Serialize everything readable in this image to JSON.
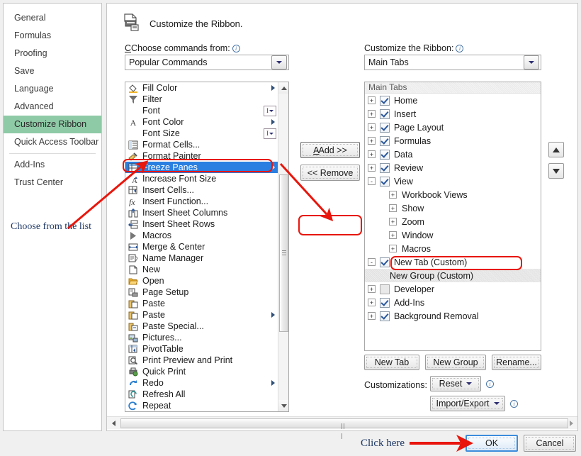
{
  "sidebar": {
    "items": [
      {
        "label": "General",
        "selected": false
      },
      {
        "label": "Formulas",
        "selected": false
      },
      {
        "label": "Proofing",
        "selected": false
      },
      {
        "label": "Save",
        "selected": false
      },
      {
        "label": "Language",
        "selected": false
      },
      {
        "label": "Advanced",
        "selected": false
      },
      {
        "label": "Customize Ribbon",
        "selected": true
      },
      {
        "label": "Quick Access Toolbar",
        "selected": false
      },
      {
        "label": "Add-Ins",
        "selected": false
      },
      {
        "label": "Trust Center",
        "selected": false
      }
    ],
    "annotation": "Choose from the list"
  },
  "header": {
    "title": "Customize the Ribbon.",
    "icon": "print-save-icon"
  },
  "left_panel": {
    "label": "Choose commands from:",
    "label_accel": "C",
    "info_icon": "info-icon",
    "combo_value": "Popular Commands",
    "commands": [
      {
        "label": "Fill Color",
        "icon": "fill-color-icon",
        "submenu": true,
        "spinner": false,
        "selected": false
      },
      {
        "label": "Filter",
        "icon": "filter-icon",
        "submenu": false,
        "spinner": false,
        "selected": false
      },
      {
        "label": "Font",
        "icon": "none",
        "submenu": false,
        "spinner": true,
        "selected": false
      },
      {
        "label": "Font Color",
        "icon": "font-color-icon",
        "submenu": true,
        "spinner": false,
        "selected": false
      },
      {
        "label": "Font Size",
        "icon": "none",
        "submenu": false,
        "spinner": true,
        "selected": false
      },
      {
        "label": "Format Cells...",
        "icon": "format-cells-icon",
        "submenu": false,
        "spinner": false,
        "selected": false
      },
      {
        "label": "Format Painter",
        "icon": "format-painter-icon",
        "submenu": false,
        "spinner": false,
        "selected": false
      },
      {
        "label": "Freeze Panes",
        "icon": "freeze-panes-icon",
        "submenu": true,
        "spinner": false,
        "selected": true
      },
      {
        "label": "Increase Font Size",
        "icon": "increase-font-size-icon",
        "submenu": false,
        "spinner": false,
        "selected": false
      },
      {
        "label": "Insert Cells...",
        "icon": "insert-cells-icon",
        "submenu": false,
        "spinner": false,
        "selected": false
      },
      {
        "label": "Insert Function...",
        "icon": "insert-function-icon",
        "submenu": false,
        "spinner": false,
        "selected": false
      },
      {
        "label": "Insert Sheet Columns",
        "icon": "insert-sheet-columns-icon",
        "submenu": false,
        "spinner": false,
        "selected": false
      },
      {
        "label": "Insert Sheet Rows",
        "icon": "insert-sheet-rows-icon",
        "submenu": false,
        "spinner": false,
        "selected": false
      },
      {
        "label": "Macros",
        "icon": "macros-icon",
        "submenu": false,
        "spinner": false,
        "selected": false
      },
      {
        "label": "Merge & Center",
        "icon": "merge-center-icon",
        "submenu": false,
        "spinner": false,
        "selected": false
      },
      {
        "label": "Name Manager",
        "icon": "name-manager-icon",
        "submenu": false,
        "spinner": false,
        "selected": false
      },
      {
        "label": "New",
        "icon": "new-file-icon",
        "submenu": false,
        "spinner": false,
        "selected": false
      },
      {
        "label": "Open",
        "icon": "open-folder-icon",
        "submenu": false,
        "spinner": false,
        "selected": false
      },
      {
        "label": "Page Setup",
        "icon": "page-setup-icon",
        "submenu": false,
        "spinner": false,
        "selected": false
      },
      {
        "label": "Paste",
        "icon": "paste-icon",
        "submenu": false,
        "spinner": false,
        "selected": false
      },
      {
        "label": "Paste",
        "icon": "paste-icon",
        "submenu": true,
        "spinner": false,
        "selected": false
      },
      {
        "label": "Paste Special...",
        "icon": "paste-special-icon",
        "submenu": false,
        "spinner": false,
        "selected": false
      },
      {
        "label": "Pictures...",
        "icon": "pictures-icon",
        "submenu": false,
        "spinner": false,
        "selected": false
      },
      {
        "label": "PivotTable",
        "icon": "pivottable-icon",
        "submenu": false,
        "spinner": false,
        "selected": false
      },
      {
        "label": "Print Preview and Print",
        "icon": "print-preview-icon",
        "submenu": false,
        "spinner": false,
        "selected": false
      },
      {
        "label": "Quick Print",
        "icon": "quick-print-icon",
        "submenu": false,
        "spinner": false,
        "selected": false
      },
      {
        "label": "Redo",
        "icon": "redo-icon",
        "submenu": true,
        "spinner": false,
        "selected": false
      },
      {
        "label": "Refresh All",
        "icon": "refresh-all-icon",
        "submenu": false,
        "spinner": false,
        "selected": false
      },
      {
        "label": "Repeat",
        "icon": "repeat-icon",
        "submenu": false,
        "spinner": false,
        "selected": false
      }
    ]
  },
  "middle": {
    "add_label": "Add >>",
    "add_accel": "A",
    "remove_label": "<< Remove",
    "remove_accel": "R"
  },
  "right_panel": {
    "label": "Customize the Ribbon:",
    "info_icon": "info-icon",
    "combo_value": "Main Tabs",
    "tree_header": "Main Tabs",
    "tree": [
      {
        "label": "Home",
        "expander": "+",
        "checkbox": "checked",
        "indent": false,
        "selected": false
      },
      {
        "label": "Insert",
        "expander": "+",
        "checkbox": "checked",
        "indent": false,
        "selected": false
      },
      {
        "label": "Page Layout",
        "expander": "+",
        "checkbox": "checked",
        "indent": false,
        "selected": false
      },
      {
        "label": "Formulas",
        "expander": "+",
        "checkbox": "checked",
        "indent": false,
        "selected": false
      },
      {
        "label": "Data",
        "expander": "+",
        "checkbox": "checked",
        "indent": false,
        "selected": false
      },
      {
        "label": "Review",
        "expander": "+",
        "checkbox": "checked",
        "indent": false,
        "selected": false
      },
      {
        "label": "View",
        "expander": "-",
        "checkbox": "checked",
        "indent": false,
        "selected": false
      },
      {
        "label": "Workbook Views",
        "expander": "+",
        "checkbox": "none",
        "indent": true,
        "selected": false
      },
      {
        "label": "Show",
        "expander": "+",
        "checkbox": "none",
        "indent": true,
        "selected": false
      },
      {
        "label": "Zoom",
        "expander": "+",
        "checkbox": "none",
        "indent": true,
        "selected": false
      },
      {
        "label": "Window",
        "expander": "+",
        "checkbox": "none",
        "indent": true,
        "selected": false
      },
      {
        "label": "Macros",
        "expander": "+",
        "checkbox": "none",
        "indent": true,
        "selected": false
      },
      {
        "label": "New Tab (Custom)",
        "expander": "-",
        "checkbox": "checked",
        "indent": false,
        "selected": false
      },
      {
        "label": "New Group (Custom)",
        "expander": "none",
        "checkbox": "none",
        "indent": true,
        "selected": true
      },
      {
        "label": "Developer",
        "expander": "+",
        "checkbox": "unchecked",
        "indent": false,
        "selected": false
      },
      {
        "label": "Add-Ins",
        "expander": "+",
        "checkbox": "checked",
        "indent": false,
        "selected": false
      },
      {
        "label": "Background Removal",
        "expander": "+",
        "checkbox": "checked",
        "indent": false,
        "selected": false
      }
    ],
    "new_tab_label": "New Tab",
    "new_tab_accel": "w",
    "new_group_label": "New Group",
    "new_group_accel": "N",
    "rename_label": "Rename...",
    "rename_accel": "m",
    "customizations_label": "Customizations:",
    "reset_label": "Reset",
    "reset_accel": "e",
    "import_export_label": "Import/Export",
    "import_export_accel": "p",
    "move_up_icon": "arrow-up-icon",
    "move_down_icon": "arrow-down-icon"
  },
  "footer": {
    "click_here_note": "Click here",
    "ok_label": "OK",
    "cancel_label": "Cancel"
  },
  "colors": {
    "selection_blue": "#2a7fe0",
    "sidebar_highlight": "#8ecaa6",
    "annotation_red": "#e8160c",
    "annotation_navy": "#1f3864",
    "ok_focus_blue": "#3c8ddc"
  }
}
